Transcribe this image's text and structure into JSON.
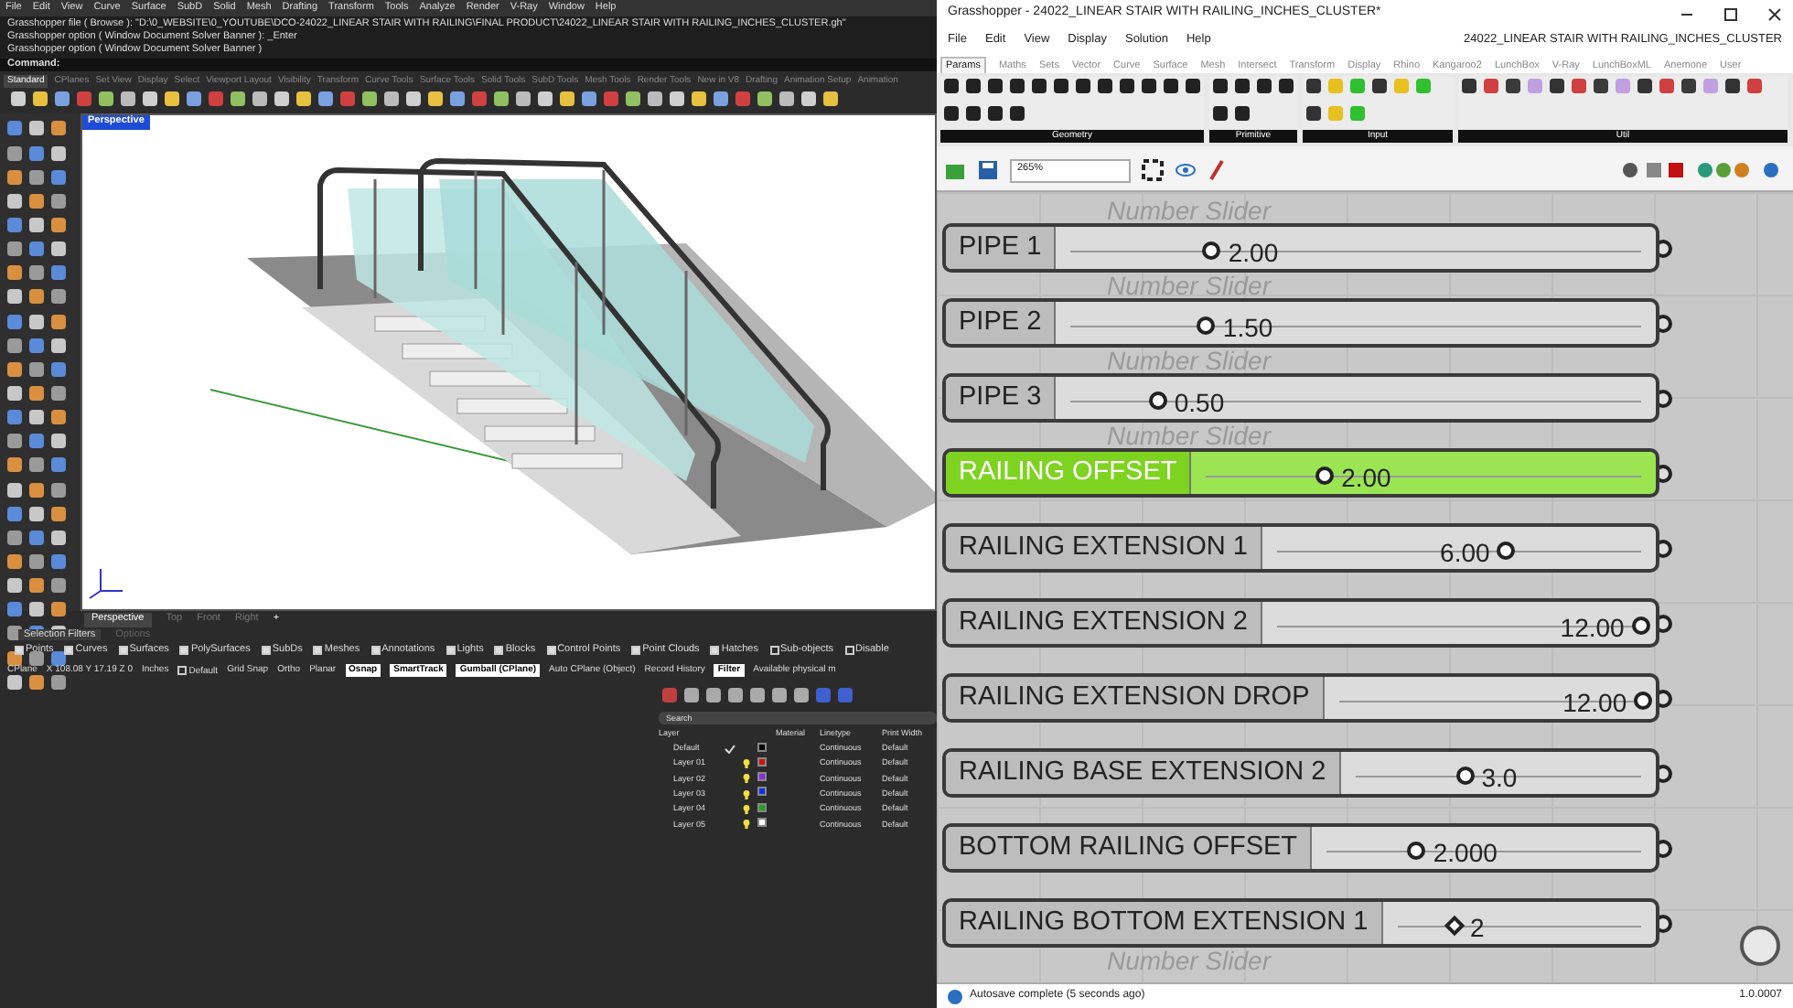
{
  "rhino": {
    "menu": [
      "File",
      "Edit",
      "View",
      "Curve",
      "Surface",
      "SubD",
      "Solid",
      "Mesh",
      "Drafting",
      "Transform",
      "Tools",
      "Analyze",
      "Render",
      "V-Ray",
      "Window",
      "Help"
    ],
    "command_history": [
      "Grasshopper file ( Browse ): \"D:\\0_WEBSITE\\0_YOUTUBE\\DCO-24022_LINEAR STAIR WITH RAILING\\FINAL PRODUCT\\24022_LINEAR STAIR WITH RAILING_INCHES_CLUSTER.gh\"",
      "Grasshopper option ( Window Document Solver Banner ): _Enter",
      "Grasshopper option ( Window Document Solver Banner )"
    ],
    "command_prompt": "Command:",
    "toolbar_tabs": [
      {
        "label": "Standard",
        "selected": true
      },
      {
        "label": "CPlanes",
        "selected": false
      },
      {
        "label": "Set View",
        "selected": false
      },
      {
        "label": "Display",
        "selected": false
      },
      {
        "label": "Select",
        "selected": false
      },
      {
        "label": "Viewport Layout",
        "selected": false
      },
      {
        "label": "Visibility",
        "selected": false
      },
      {
        "label": "Transform",
        "selected": false
      },
      {
        "label": "Curve Tools",
        "selected": false
      },
      {
        "label": "Surface Tools",
        "selected": false
      },
      {
        "label": "Solid Tools",
        "selected": false
      },
      {
        "label": "SubD Tools",
        "selected": false
      },
      {
        "label": "Mesh Tools",
        "selected": false
      },
      {
        "label": "Render Tools",
        "selected": false
      },
      {
        "label": "New in V8",
        "selected": false
      },
      {
        "label": "Drafting",
        "selected": false
      },
      {
        "label": "Animation Setup",
        "selected": false
      },
      {
        "label": "Animation",
        "selected": false
      }
    ],
    "viewport": {
      "label": "Perspective"
    },
    "viewport_tabs": [
      {
        "label": "Perspective",
        "selected": true
      },
      {
        "label": "Top",
        "selected": false
      },
      {
        "label": "Front",
        "selected": false
      },
      {
        "label": "Right",
        "selected": false
      }
    ],
    "add_tab": "+",
    "filter_tabs": [
      {
        "label": "Selection Filters",
        "selected": true
      },
      {
        "label": "Options",
        "selected": false
      }
    ],
    "filters": [
      {
        "label": "Points",
        "checked": true
      },
      {
        "label": "Curves",
        "checked": true
      },
      {
        "label": "Surfaces",
        "checked": true
      },
      {
        "label": "PolySurfaces",
        "checked": true
      },
      {
        "label": "SubDs",
        "checked": true
      },
      {
        "label": "Meshes",
        "checked": true
      },
      {
        "label": "Annotations",
        "checked": true
      },
      {
        "label": "Lights",
        "checked": true
      },
      {
        "label": "Blocks",
        "checked": true
      },
      {
        "label": "Control Points",
        "checked": true
      },
      {
        "label": "Point Clouds",
        "checked": true
      },
      {
        "label": "Hatches",
        "checked": true
      },
      {
        "label": "Sub-objects",
        "checked": false
      },
      {
        "label": "Disable",
        "checked": false
      }
    ],
    "status_bar": {
      "cplane": "CPlane",
      "coordinates": "X 108.08 Y 17.19 Z 0",
      "units": "Inches",
      "layer": "Default",
      "toggles": [
        {
          "label": "Grid Snap",
          "on": false
        },
        {
          "label": "Ortho",
          "on": false
        },
        {
          "label": "Planar",
          "on": false
        },
        {
          "label": "Osnap",
          "on": true
        },
        {
          "label": "SmartTrack",
          "on": true
        },
        {
          "label": "Gumball (CPlane)",
          "on": true
        },
        {
          "label": "Auto CPlane (Object)",
          "on": false
        },
        {
          "label": "Record History",
          "on": false
        },
        {
          "label": "Filter",
          "on": true
        },
        {
          "label": "Available physical m",
          "on": false
        }
      ]
    },
    "layers": {
      "search_placeholder": "Search",
      "columns": [
        "Layer",
        "Material",
        "Linetype",
        "Print Width"
      ],
      "rows": [
        {
          "name": "Default",
          "current": true,
          "color": "#000000",
          "linetype": "Continuous",
          "print_width": "Default"
        },
        {
          "name": "Layer 01",
          "current": false,
          "color": "#d01010",
          "linetype": "Continuous",
          "print_width": "Default"
        },
        {
          "name": "Layer 02",
          "current": false,
          "color": "#8a2be2",
          "linetype": "Continuous",
          "print_width": "Default"
        },
        {
          "name": "Layer 03",
          "current": false,
          "color": "#1030f0",
          "linetype": "Continuous",
          "print_width": "Default"
        },
        {
          "name": "Layer 04",
          "current": false,
          "color": "#20a020",
          "linetype": "Continuous",
          "print_width": "Default"
        },
        {
          "name": "Layer 05",
          "current": false,
          "color": "#ffffff",
          "linetype": "Continuous",
          "print_width": "Default"
        }
      ]
    }
  },
  "grasshopper": {
    "title": "Grasshopper - 24022_LINEAR STAIR WITH RAILING_INCHES_CLUSTER*",
    "menu": [
      "File",
      "Edit",
      "View",
      "Display",
      "Solution",
      "Help"
    ],
    "document_name": "24022_LINEAR STAIR WITH RAILING_INCHES_CLUSTER",
    "tabs": [
      {
        "label": "Params",
        "selected": true
      },
      {
        "label": "Maths",
        "selected": false
      },
      {
        "label": "Sets",
        "selected": false
      },
      {
        "label": "Vector",
        "selected": false
      },
      {
        "label": "Curve",
        "selected": false
      },
      {
        "label": "Surface",
        "selected": false
      },
      {
        "label": "Mesh",
        "selected": false
      },
      {
        "label": "Intersect",
        "selected": false
      },
      {
        "label": "Transform",
        "selected": false
      },
      {
        "label": "Display",
        "selected": false
      },
      {
        "label": "Rhino",
        "selected": false
      },
      {
        "label": "Kangaroo2",
        "selected": false
      },
      {
        "label": "LunchBox",
        "selected": false
      },
      {
        "label": "V-Ray",
        "selected": false
      },
      {
        "label": "LunchBoxML",
        "selected": false
      },
      {
        "label": "Anemone",
        "selected": false
      },
      {
        "label": "User",
        "selected": false
      }
    ],
    "groups": [
      "Geometry",
      "Primitive",
      "Input",
      "Util"
    ],
    "zoom": "265%",
    "sliders": [
      {
        "label": "PIPE 1",
        "value": "2.00",
        "level": 0.2,
        "selected": false,
        "kind": "circle",
        "caption": "Number Slider"
      },
      {
        "label": "PIPE 2",
        "value": "1.50",
        "level": 0.19,
        "selected": false,
        "kind": "circle",
        "caption": "Number Slider"
      },
      {
        "label": "PIPE 3",
        "value": "0.50",
        "level": 0.1,
        "selected": false,
        "kind": "circle",
        "caption": "Number Slider"
      },
      {
        "label": "RAILING OFFSET",
        "value": "2.00",
        "level": 0.23,
        "selected": true,
        "kind": "circle",
        "caption": "Number Slider"
      },
      {
        "label": "RAILING EXTENSION 1",
        "value": "6.00",
        "level": 0.6,
        "selected": false,
        "kind": "circle"
      },
      {
        "label": "RAILING EXTENSION 2",
        "value": "12.00",
        "level": 0.98,
        "selected": false,
        "kind": "circle"
      },
      {
        "label": "RAILING EXTENSION DROP",
        "value": "12.00",
        "level": 0.98,
        "selected": false,
        "kind": "circle"
      },
      {
        "label": "RAILING BASE EXTENSION 2",
        "value": "3.0",
        "level": 0.35,
        "selected": false,
        "kind": "circle"
      },
      {
        "label": "BOTTOM RAILING OFFSET",
        "value": "2.000",
        "level": 0.25,
        "selected": false,
        "kind": "circle"
      },
      {
        "label": "RAILING BOTTOM EXTENSION 1",
        "value": "2",
        "level": 0.2,
        "selected": false,
        "kind": "diamond"
      }
    ],
    "bottom_caption": "Number Slider",
    "status": "Autosave complete (5 seconds ago)",
    "version": "1.0.0007"
  }
}
